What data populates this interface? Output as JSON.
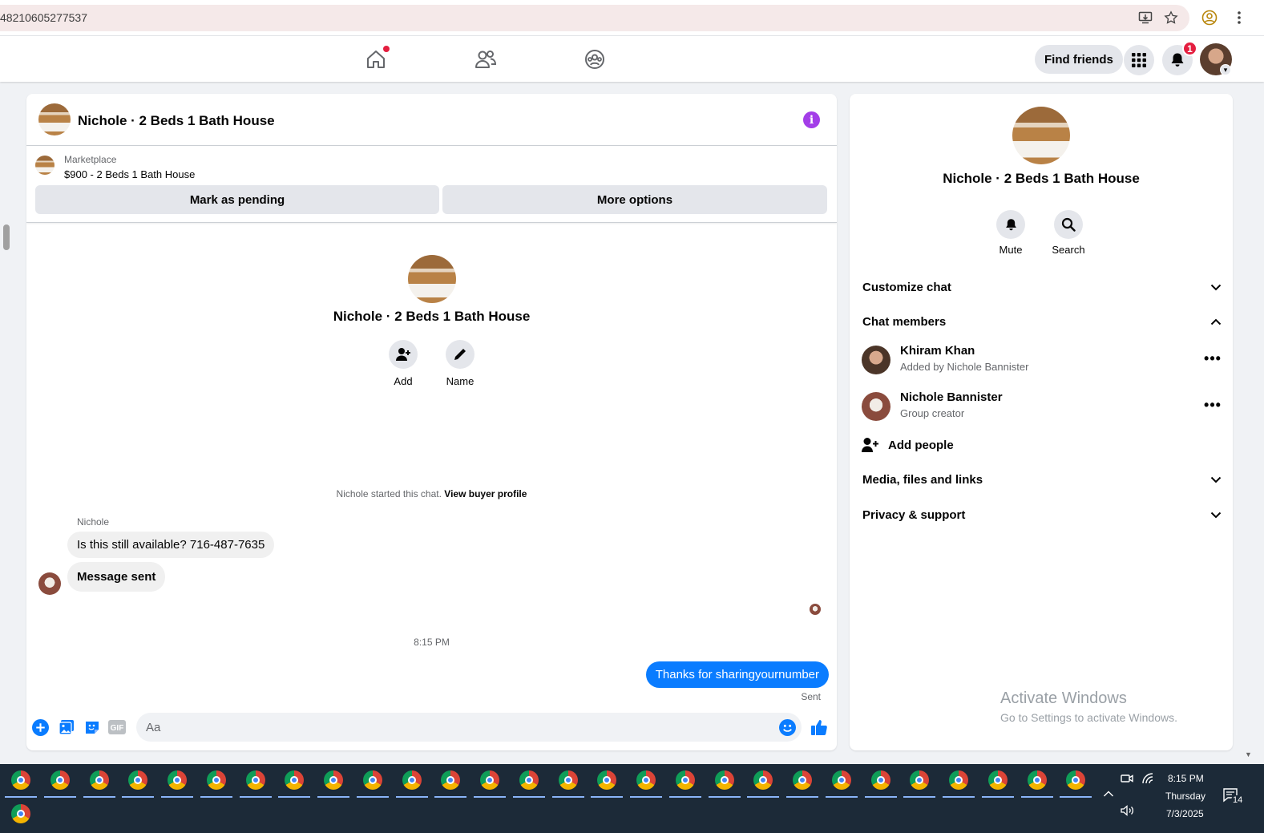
{
  "browser": {
    "url": "48210605277537"
  },
  "nav": {
    "find_friends": "Find friends",
    "notification_count": "1"
  },
  "chat": {
    "header_title": "Nichole · 2 Beds 1 Bath House",
    "marketplace_label": "Marketplace",
    "listing": "$900 - 2 Beds 1 Bath House",
    "mark_pending": "Mark as pending",
    "more_options": "More options",
    "center_title": "Nichole · 2 Beds 1 Bath House",
    "add_label": "Add",
    "name_label": "Name",
    "started_text": "Nichole started this chat.",
    "view_buyer_profile": "View buyer profile",
    "sender_name": "Nichole",
    "messages_in": [
      "Is this still available? 716-487-7635",
      "Message sent"
    ],
    "time": "8:15 PM",
    "message_out": "Thanks for sharingyournumber",
    "sent_label": "Sent",
    "composer_placeholder": "Aa",
    "gif_label": "GIF"
  },
  "info_panel": {
    "title": "Nichole · 2 Beds 1 Bath House",
    "mute_label": "Mute",
    "search_label": "Search",
    "customize_chat": "Customize chat",
    "chat_members": "Chat members",
    "members": [
      {
        "name": "Khiram Khan",
        "sub": "Added by Nichole Bannister"
      },
      {
        "name": "Nichole Bannister",
        "sub": "Group creator"
      }
    ],
    "add_people": "Add people",
    "media_files_links": "Media, files and links",
    "privacy_support": "Privacy & support",
    "watermark_title": "Activate Windows",
    "watermark_sub": "Go to Settings to activate Windows."
  },
  "taskbar": {
    "time": "8:15 PM",
    "day": "Thursday",
    "date": "7/3/2025",
    "notification_count": "14"
  },
  "colors": {
    "accent": "#0a7cff",
    "info": "#a33ee8",
    "badge": "#e41e3f",
    "taskbar": "#1c2a38"
  }
}
